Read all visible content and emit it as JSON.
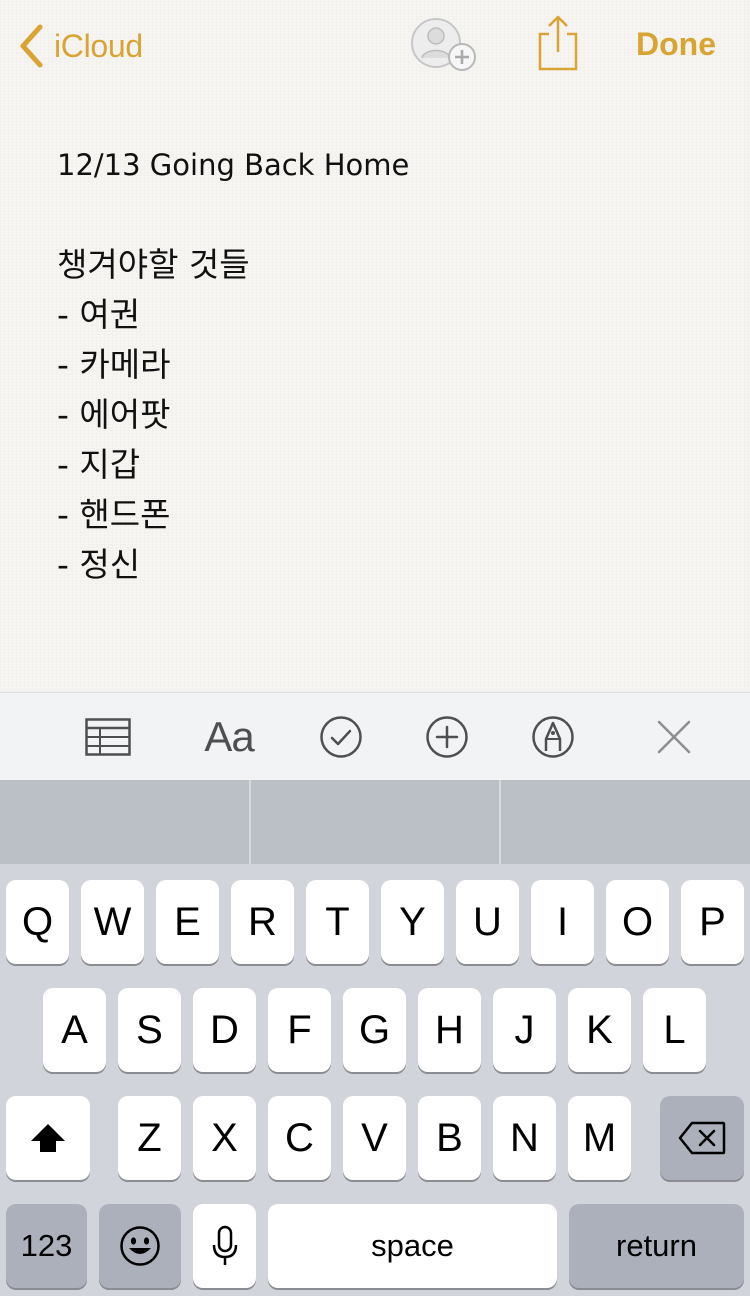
{
  "nav": {
    "back_label": "iCloud",
    "done_label": "Done",
    "accent_color": "#d9a434"
  },
  "note": {
    "title": "12/13 Going Back Home",
    "lines": [
      "챙겨야할 것들",
      "- 여권",
      "- 카메라",
      "- 에어팟",
      "- 지갑",
      "- 핸드폰",
      "- 정신"
    ]
  },
  "format_toolbar": {
    "icons": [
      "table-icon",
      "text-format-icon",
      "checklist-icon",
      "add-icon",
      "markup-icon",
      "close-icon"
    ],
    "text_format_label": "Aa"
  },
  "keyboard": {
    "row1": [
      "Q",
      "W",
      "E",
      "R",
      "T",
      "Y",
      "U",
      "I",
      "O",
      "P"
    ],
    "row2": [
      "A",
      "S",
      "D",
      "F",
      "G",
      "H",
      "J",
      "K",
      "L"
    ],
    "row3": [
      "Z",
      "X",
      "C",
      "V",
      "B",
      "N",
      "M"
    ],
    "numbers_label": "123",
    "space_label": "space",
    "return_label": "return"
  }
}
